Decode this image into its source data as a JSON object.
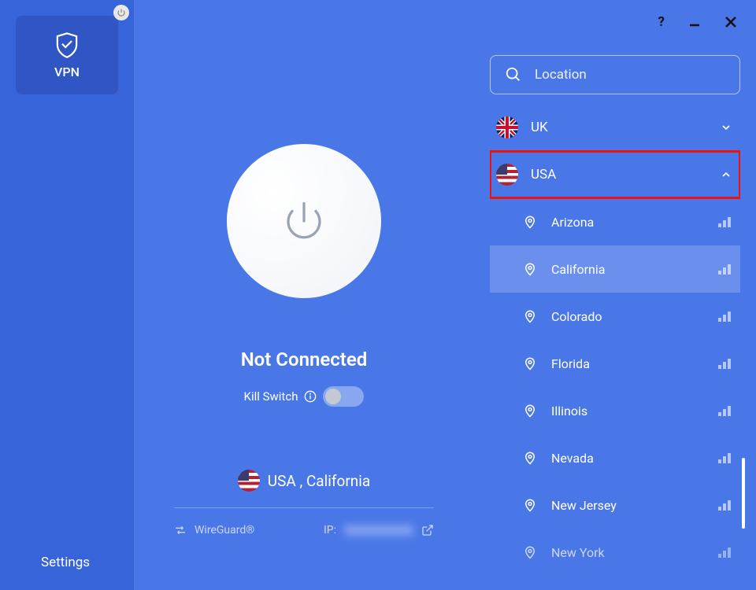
{
  "sidebar": {
    "vpn_label": "VPN",
    "settings_label": "Settings"
  },
  "main": {
    "status": "Not Connected",
    "killswitch_label": "Kill Switch",
    "selected_location": "USA , California",
    "protocol_label": "WireGuard®",
    "ip_label": "IP:"
  },
  "search": {
    "placeholder": "Location"
  },
  "countries": {
    "uk": {
      "label": "UK",
      "expanded": false
    },
    "usa": {
      "label": "USA",
      "expanded": true
    }
  },
  "usa_cities": [
    {
      "label": "Arizona",
      "selected": false
    },
    {
      "label": "California",
      "selected": true
    },
    {
      "label": "Colorado",
      "selected": false
    },
    {
      "label": "Florida",
      "selected": false
    },
    {
      "label": "Illinois",
      "selected": false
    },
    {
      "label": "Nevada",
      "selected": false
    },
    {
      "label": "New Jersey",
      "selected": false
    },
    {
      "label": "New York",
      "selected": false
    }
  ]
}
